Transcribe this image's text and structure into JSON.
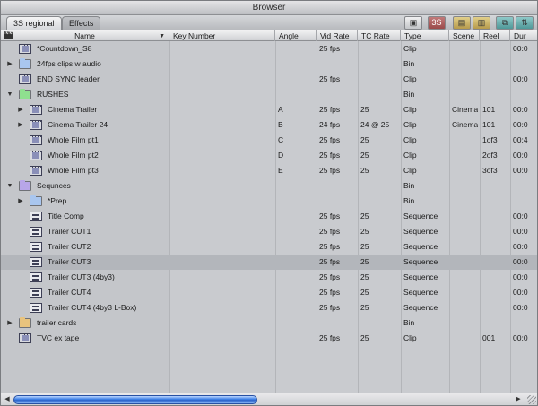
{
  "window": {
    "title": "Browser"
  },
  "tabs": [
    {
      "label": "3S regional",
      "active": true
    },
    {
      "label": "Effects",
      "active": false
    }
  ],
  "toolbar": {
    "buttons": [
      {
        "name": "large-icon-view",
        "glyph": "▣"
      },
      {
        "name": "list-view",
        "glyph": "3S"
      },
      {
        "name": "folder-view",
        "glyph": "▤"
      },
      {
        "name": "bin-view",
        "glyph": "▥"
      },
      {
        "name": "export",
        "glyph": "⧉"
      },
      {
        "name": "import",
        "glyph": "⇅"
      }
    ]
  },
  "columns": [
    {
      "key": "name",
      "label": "Name"
    },
    {
      "key": "key_number",
      "label": "Key Number"
    },
    {
      "key": "angle",
      "label": "Angle"
    },
    {
      "key": "vid_rate",
      "label": "Vid Rate"
    },
    {
      "key": "tc_rate",
      "label": "TC Rate"
    },
    {
      "key": "type",
      "label": "Type"
    },
    {
      "key": "scene",
      "label": "Scene"
    },
    {
      "key": "reel",
      "label": "Reel"
    },
    {
      "key": "dur",
      "label": "Dur"
    }
  ],
  "rows": [
    {
      "name": "*Countdown_S8",
      "icon": "clip",
      "indent": 0,
      "expand": "",
      "angle": "",
      "vid_rate": "25 fps",
      "tc_rate": "",
      "type": "Clip",
      "scene": "",
      "reel": "",
      "dur": "00:0"
    },
    {
      "name": "24fps clips w audio",
      "icon": "folder-blue",
      "indent": 0,
      "expand": "▶",
      "angle": "",
      "vid_rate": "",
      "tc_rate": "",
      "type": "Bin",
      "scene": "",
      "reel": "",
      "dur": ""
    },
    {
      "name": "END SYNC leader",
      "icon": "clip",
      "indent": 0,
      "expand": "",
      "angle": "",
      "vid_rate": "25 fps",
      "tc_rate": "",
      "type": "Clip",
      "scene": "",
      "reel": "",
      "dur": "00:0"
    },
    {
      "name": "RUSHES",
      "icon": "folder-green",
      "indent": 0,
      "expand": "▼",
      "angle": "",
      "vid_rate": "",
      "tc_rate": "",
      "type": "Bin",
      "scene": "",
      "reel": "",
      "dur": ""
    },
    {
      "name": "Cinema Trailer",
      "icon": "clip",
      "indent": 1,
      "expand": "▶",
      "angle": "A",
      "vid_rate": "25 fps",
      "tc_rate": "25",
      "type": "Clip",
      "scene": "Cinema",
      "reel": "101",
      "dur": "00:0"
    },
    {
      "name": "Cinema Trailer 24",
      "icon": "clip",
      "indent": 1,
      "expand": "▶",
      "angle": "B",
      "vid_rate": "24 fps",
      "tc_rate": "24 @ 25",
      "type": "Clip",
      "scene": "Cinema",
      "reel": "101",
      "dur": "00:0"
    },
    {
      "name": "Whole Film pt1",
      "icon": "clip",
      "indent": 1,
      "expand": "",
      "angle": "C",
      "vid_rate": "25 fps",
      "tc_rate": "25",
      "type": "Clip",
      "scene": "",
      "reel": "1of3",
      "dur": "00:4"
    },
    {
      "name": "Whole Film pt2",
      "icon": "clip",
      "indent": 1,
      "expand": "",
      "angle": "D",
      "vid_rate": "25 fps",
      "tc_rate": "25",
      "type": "Clip",
      "scene": "",
      "reel": "2of3",
      "dur": "00:0"
    },
    {
      "name": "Whole Film pt3",
      "icon": "clip",
      "indent": 1,
      "expand": "",
      "angle": "E",
      "vid_rate": "25 fps",
      "tc_rate": "25",
      "type": "Clip",
      "scene": "",
      "reel": "3of3",
      "dur": "00:0"
    },
    {
      "name": "Sequnces",
      "icon": "folder-purple",
      "indent": 0,
      "expand": "▼",
      "angle": "",
      "vid_rate": "",
      "tc_rate": "",
      "type": "Bin",
      "scene": "",
      "reel": "",
      "dur": ""
    },
    {
      "name": "*Prep",
      "icon": "folder-blue",
      "indent": 1,
      "expand": "▶",
      "angle": "",
      "vid_rate": "",
      "tc_rate": "",
      "type": "Bin",
      "scene": "",
      "reel": "",
      "dur": ""
    },
    {
      "name": "Title Comp",
      "icon": "sequence",
      "indent": 1,
      "expand": "",
      "angle": "",
      "vid_rate": "25 fps",
      "tc_rate": "25",
      "type": "Sequence",
      "scene": "",
      "reel": "",
      "dur": "00:0"
    },
    {
      "name": "Trailer CUT1",
      "icon": "sequence",
      "indent": 1,
      "expand": "",
      "angle": "",
      "vid_rate": "25 fps",
      "tc_rate": "25",
      "type": "Sequence",
      "scene": "",
      "reel": "",
      "dur": "00:0"
    },
    {
      "name": "Trailer CUT2",
      "icon": "sequence",
      "indent": 1,
      "expand": "",
      "angle": "",
      "vid_rate": "25 fps",
      "tc_rate": "25",
      "type": "Sequence",
      "scene": "",
      "reel": "",
      "dur": "00:0"
    },
    {
      "name": "Trailer CUT3",
      "icon": "sequence",
      "indent": 1,
      "expand": "",
      "angle": "",
      "vid_rate": "25 fps",
      "tc_rate": "25",
      "type": "Sequence",
      "scene": "",
      "reel": "",
      "dur": "00:0",
      "selected": true
    },
    {
      "name": "Trailer CUT3 (4by3)",
      "icon": "sequence",
      "indent": 1,
      "expand": "",
      "angle": "",
      "vid_rate": "25 fps",
      "tc_rate": "25",
      "type": "Sequence",
      "scene": "",
      "reel": "",
      "dur": "00:0"
    },
    {
      "name": "Trailer CUT4",
      "icon": "sequence",
      "indent": 1,
      "expand": "",
      "angle": "",
      "vid_rate": "25 fps",
      "tc_rate": "25",
      "type": "Sequence",
      "scene": "",
      "reel": "",
      "dur": "00:0"
    },
    {
      "name": "Trailer CUT4 (4by3 L-Box)",
      "icon": "sequence",
      "indent": 1,
      "expand": "",
      "angle": "",
      "vid_rate": "25 fps",
      "tc_rate": "25",
      "type": "Sequence",
      "scene": "",
      "reel": "",
      "dur": "00:0"
    },
    {
      "name": "trailer cards",
      "icon": "folder-orange",
      "indent": 0,
      "expand": "▶",
      "angle": "",
      "vid_rate": "",
      "tc_rate": "",
      "type": "Bin",
      "scene": "",
      "reel": "",
      "dur": ""
    },
    {
      "name": "TVC ex tape",
      "icon": "clip",
      "indent": 0,
      "expand": "",
      "angle": "",
      "vid_rate": "25 fps",
      "tc_rate": "25",
      "type": "Clip",
      "scene": "",
      "reel": "001",
      "dur": "00:0"
    }
  ],
  "colors": {
    "folder-blue": "#a9c6ef",
    "folder-green": "#8fe08f",
    "folder-purple": "#b8a6e8",
    "folder-orange": "#e8c37d",
    "selection": "#b3b6bb",
    "scroll_thumb": "#3a7ee6"
  }
}
